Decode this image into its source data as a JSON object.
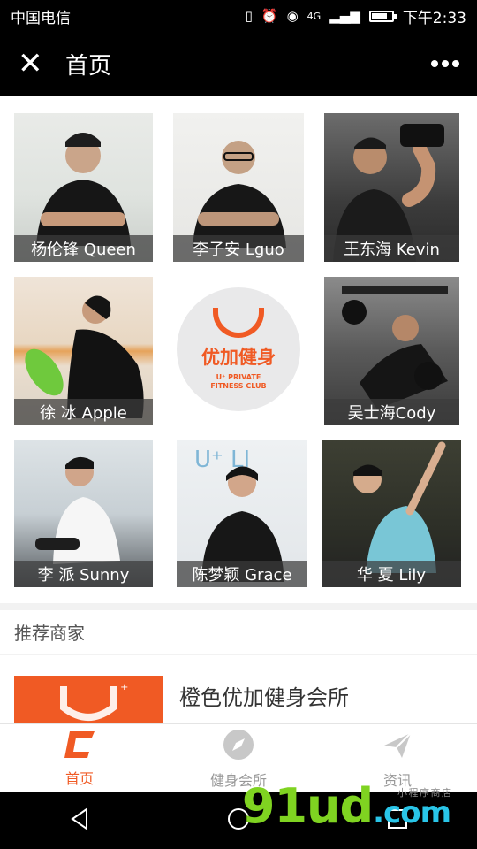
{
  "status": {
    "carrier": "中国电信",
    "time": "下午2:33",
    "network": "4G"
  },
  "nav": {
    "title": "首页"
  },
  "trainers": [
    {
      "label": "杨伦锋 Queen"
    },
    {
      "label": "李子安 Lguo"
    },
    {
      "label": "王东海 Kevin"
    },
    {
      "label": "徐 冰 Apple"
    },
    {
      "label": "吴士海Cody"
    },
    {
      "label": "李 派 Sunny"
    },
    {
      "label": "陈梦颖 Grace"
    },
    {
      "label": "华 夏 Lily"
    }
  ],
  "logo": {
    "name": "优加健身",
    "sub1": "U⁺ PRIVATE",
    "sub2": "FITNESS CLUB"
  },
  "section": {
    "heading": "推荐商家"
  },
  "merchant": {
    "name": "橙色优加健身会所"
  },
  "tabs": [
    {
      "label": "首页",
      "icon": "home-logo-icon",
      "active": true
    },
    {
      "label": "健身会所",
      "icon": "compass-icon",
      "active": false
    },
    {
      "label": "资讯",
      "icon": "plane-icon",
      "active": false
    }
  ],
  "watermark": {
    "brand": "91ud",
    "domain": ".com",
    "tagline": "小 程 序 商 店"
  },
  "colors": {
    "accent": "#f05a24",
    "watermark_blue": "#29c5e8",
    "watermark_green": "#7fd321"
  }
}
